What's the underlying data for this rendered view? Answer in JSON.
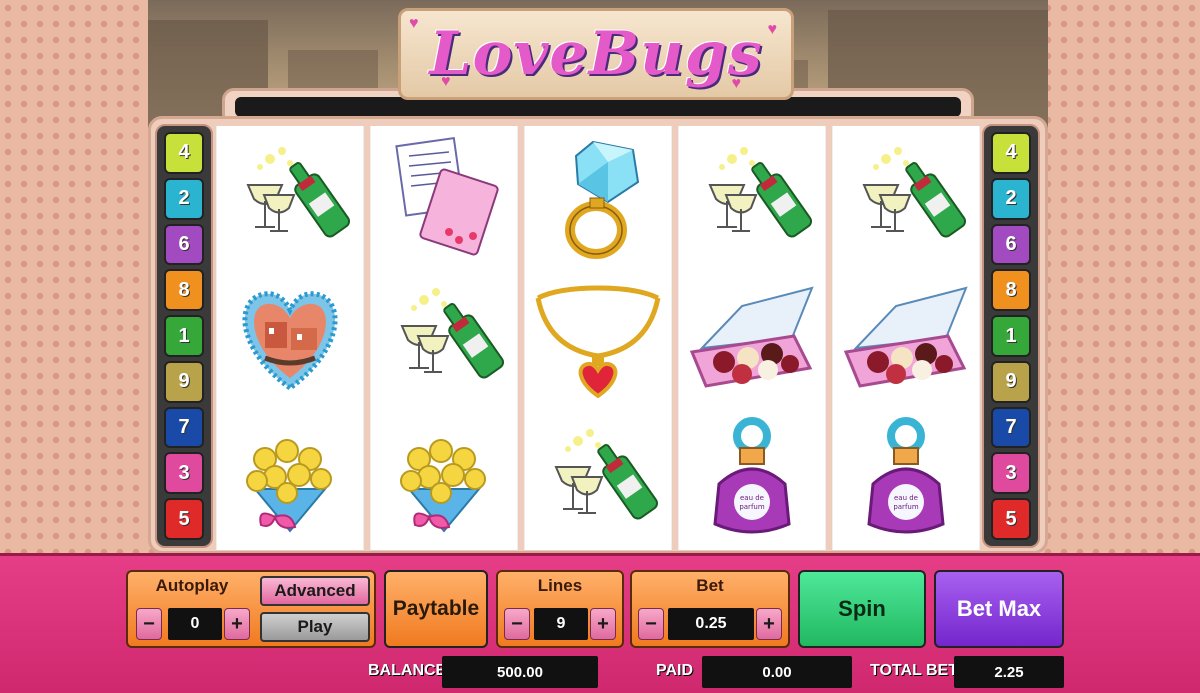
{
  "logo": {
    "text": "LoveBugs"
  },
  "paylines": {
    "left": [
      {
        "num": "4",
        "color": "#c8e03a"
      },
      {
        "num": "2",
        "color": "#2ab4d0"
      },
      {
        "num": "6",
        "color": "#a24ac0"
      },
      {
        "num": "8",
        "color": "#f0901e"
      },
      {
        "num": "1",
        "color": "#36a83a"
      },
      {
        "num": "9",
        "color": "#b8a24a"
      },
      {
        "num": "7",
        "color": "#1a4aa8"
      },
      {
        "num": "3",
        "color": "#e04a9e"
      },
      {
        "num": "5",
        "color": "#e02a2a"
      }
    ],
    "right": [
      {
        "num": "4",
        "color": "#c8e03a"
      },
      {
        "num": "2",
        "color": "#2ab4d0"
      },
      {
        "num": "6",
        "color": "#a24ac0"
      },
      {
        "num": "8",
        "color": "#f0901e"
      },
      {
        "num": "1",
        "color": "#36a83a"
      },
      {
        "num": "9",
        "color": "#b8a24a"
      },
      {
        "num": "7",
        "color": "#1a4aa8"
      },
      {
        "num": "3",
        "color": "#e04a9e"
      },
      {
        "num": "5",
        "color": "#e02a2a"
      }
    ]
  },
  "reels": [
    [
      "champagne-icon",
      "venice-heart-icon",
      "roses-bouquet-icon"
    ],
    [
      "love-letter-icon",
      "champagne-icon",
      "roses-bouquet-icon"
    ],
    [
      "diamond-ring-icon",
      "heart-necklace-icon",
      "champagne-icon"
    ],
    [
      "champagne-icon",
      "chocolate-box-icon",
      "perfume-bottle-icon"
    ],
    [
      "champagne-icon",
      "chocolate-box-icon",
      "perfume-bottle-icon"
    ]
  ],
  "controls": {
    "autoplay": {
      "label": "Autoplay",
      "value": "0",
      "minus": "−",
      "plus": "+"
    },
    "advanced_label": "Advanced",
    "play_label": "Play",
    "paytable_label": "Paytable",
    "lines": {
      "label": "Lines",
      "value": "9",
      "minus": "−",
      "plus": "+"
    },
    "bet": {
      "label": "Bet",
      "value": "0.25",
      "minus": "−",
      "plus": "+"
    },
    "spin_label": "Spin",
    "betmax_label": "Bet Max"
  },
  "stats": {
    "balance_label": "BALANCE",
    "balance_value": "500.00",
    "paid_label": "PAID",
    "paid_value": "0.00",
    "totalbet_label": "TOTAL BET",
    "totalbet_value": "2.25"
  },
  "colors": {
    "panel": "#e63e86",
    "spin": "#2ecf76",
    "betmax": "#8a3ae0",
    "accent_orange": "#f07a20"
  }
}
